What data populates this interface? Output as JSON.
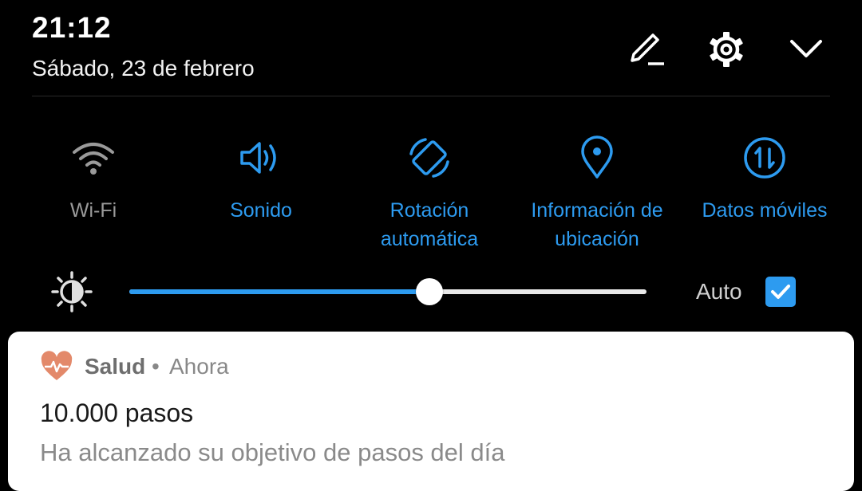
{
  "header": {
    "time": "21:12",
    "date": "Sábado, 23 de febrero",
    "icons": [
      "edit-icon",
      "gear-icon",
      "chevron-down-icon"
    ]
  },
  "tiles": [
    {
      "label": "Wi-Fi",
      "icon": "wifi-icon",
      "active": false
    },
    {
      "label": "Sonido",
      "icon": "volume-icon",
      "active": true
    },
    {
      "label": "Rotación automática",
      "icon": "rotation-icon",
      "active": true
    },
    {
      "label": "Información de ubicación",
      "icon": "location-icon",
      "active": true
    },
    {
      "label": "Datos móviles",
      "icon": "mobile-data-icon",
      "active": true
    }
  ],
  "brightness": {
    "level": 0.58,
    "auto_label": "Auto",
    "auto_checked": true
  },
  "notification": {
    "app": "Salud",
    "separator": "•",
    "time": "Ahora",
    "title": "10.000 pasos",
    "text": "Ha alcanzado su objetivo de pasos del día"
  },
  "colors": {
    "accent": "#2d9bf0",
    "inactive": "#9a9a9a",
    "health_icon": "#e3896a"
  }
}
